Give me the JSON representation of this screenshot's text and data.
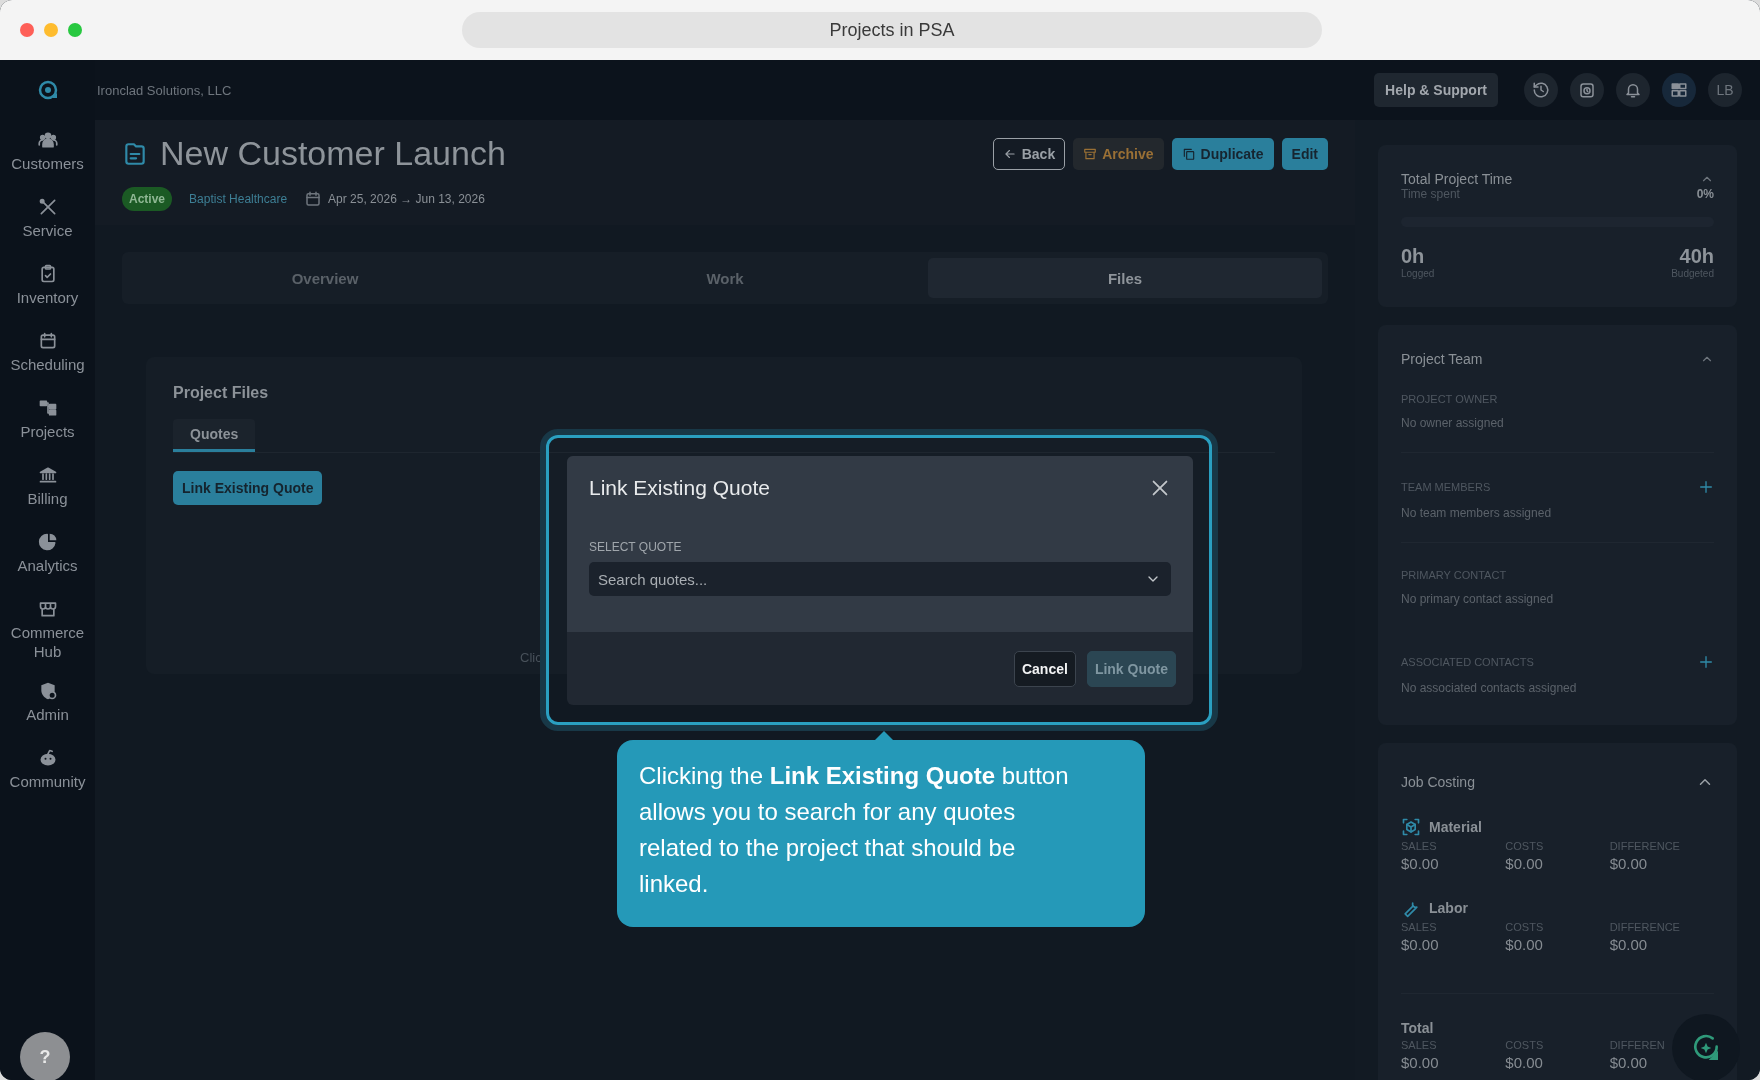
{
  "window": {
    "title": "Projects in PSA"
  },
  "header": {
    "company": "Ironclad Solutions, LLC",
    "help_button": "Help & Support",
    "avatar": "LB",
    "help_fab": "?"
  },
  "sidebar": {
    "items": [
      {
        "label": "Customers"
      },
      {
        "label": "Service"
      },
      {
        "label": "Inventory"
      },
      {
        "label": "Scheduling"
      },
      {
        "label": "Projects"
      },
      {
        "label": "Billing"
      },
      {
        "label": "Analytics"
      },
      {
        "label": "Commerce Hub"
      },
      {
        "label": "Admin"
      },
      {
        "label": "Community"
      }
    ]
  },
  "project": {
    "title": "New Customer Launch",
    "status": "Active",
    "customer": "Baptist Healthcare",
    "dates": "Apr 25, 2026 → Jun 13, 2026"
  },
  "actions": [
    {
      "label": "Back",
      "kind": "outline"
    },
    {
      "label": "Archive",
      "kind": "warning"
    },
    {
      "label": "Duplicate",
      "kind": "primary"
    },
    {
      "label": "Edit",
      "kind": "primary"
    }
  ],
  "tabs": [
    {
      "label": "Overview",
      "selected": false
    },
    {
      "label": "Work",
      "selected": false
    },
    {
      "label": "Files",
      "selected": true
    }
  ],
  "files": {
    "title": "Project Files",
    "tabs": [
      {
        "label": "Quotes",
        "selected": true
      }
    ],
    "button": "Link Existing Quote",
    "hint": "Clic"
  },
  "dialog": {
    "title": "Link Existing Quote",
    "field_label": "SELECT QUOTE",
    "placeholder": "Search quotes...",
    "buttons": [
      {
        "label": "Cancel",
        "kind": "secondary",
        "disabled": false
      },
      {
        "label": "Link Quote",
        "kind": "primary",
        "disabled": true
      }
    ]
  },
  "tooltip": {
    "text": "Clicking the **Link Existing Quote** button allows you to search for any quotes related to the project that should be linked."
  },
  "time_card": {
    "title": "Total Project Time",
    "subtitle": "Time spent",
    "percent": "0%",
    "level": 0,
    "logged": "0h",
    "logged_label": "Logged",
    "budgeted": "40h",
    "budgeted_label": "Budgeted"
  },
  "team_card": {
    "title": "Project Team",
    "sections": [
      {
        "kind": "field",
        "label": "PROJECT OWNER",
        "value": "No owner assigned"
      },
      {
        "kind": "divider"
      },
      {
        "kind": "addable",
        "label": "TEAM MEMBERS",
        "value": "No team members assigned"
      },
      {
        "kind": "divider"
      },
      {
        "kind": "field",
        "label": "PRIMARY CONTACT",
        "value": "No primary contact assigned"
      },
      {
        "kind": "addable",
        "label": "ASSOCIATED CONTACTS",
        "value": "No associated contacts assigned"
      }
    ]
  },
  "costing": {
    "title": "Job Costing",
    "groups": [
      {
        "name": "Material",
        "kind": "material",
        "columns": [
          {
            "label": "SALES",
            "value": "$0.00"
          },
          {
            "label": "COSTS",
            "value": "$0.00"
          },
          {
            "label": "DIFFERENCE",
            "value": "$0.00"
          }
        ]
      },
      {
        "name": "Labor",
        "kind": "labor",
        "columns": [
          {
            "label": "SALES",
            "value": "$0.00"
          },
          {
            "label": "COSTS",
            "value": "$0.00"
          },
          {
            "label": "DIFFERENCE",
            "value": "$0.00"
          }
        ]
      },
      {
        "name": "Total",
        "kind": "total",
        "columns": [
          {
            "label": "SALES",
            "value": "$0.00"
          },
          {
            "label": "COSTS",
            "value": "$0.00"
          },
          {
            "label": "DIFFEREN",
            "value": "$0.00"
          }
        ]
      }
    ]
  }
}
